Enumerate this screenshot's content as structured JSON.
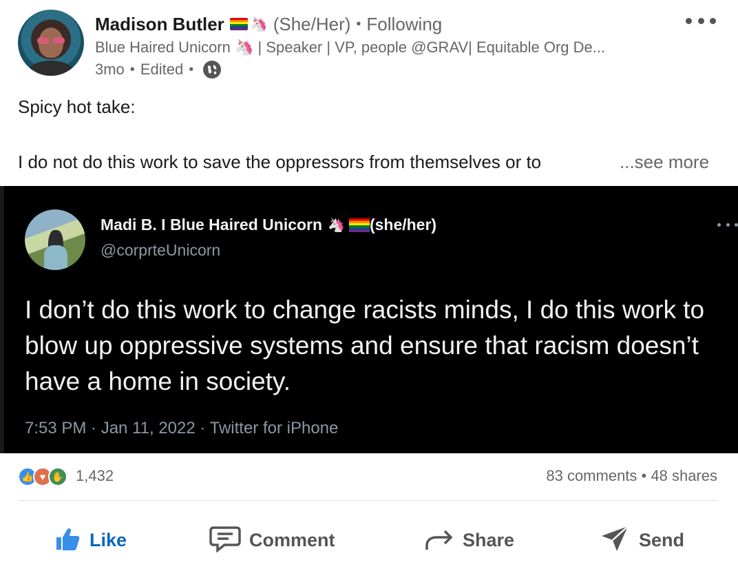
{
  "post": {
    "author": {
      "name": "Madison Butler",
      "pronouns": "(She/Her)",
      "connection": "Following",
      "headline": "Blue Haired Unicorn 🦄 | Speaker | VP, people @GRAV| Equitable Org De...",
      "age": "3mo",
      "edited": "Edited",
      "visibility_icon": "globe-icon"
    },
    "text_line_1": "Spicy hot take:",
    "text_line_2": "I do not do this work to save the oppressors from themselves or to",
    "see_more": "...see more",
    "more_icon": "ellipsis-icon"
  },
  "tweet": {
    "display_name": "Madi B. I Blue Haired Unicorn",
    "pronouns": "(she/her)",
    "handle": "@corprteUnicorn",
    "body": "I don’t do this work to change racists minds, I do this work to blow up oppressive systems and ensure that racism doesn’t have a home in society.",
    "meta": "7:53 PM · Jan 11, 2022 · Twitter for iPhone"
  },
  "social": {
    "reaction_icons": [
      "like-reaction-icon",
      "love-reaction-icon",
      "support-reaction-icon"
    ],
    "reaction_count": "1,432",
    "comments": "83 comments",
    "shares": "48 shares"
  },
  "actions": {
    "like": "Like",
    "comment": "Comment",
    "share": "Share",
    "send": "Send"
  },
  "colors": {
    "accent_blue": "#0a66c2",
    "tweet_bg": "#000000",
    "muted_text": "#666666"
  }
}
